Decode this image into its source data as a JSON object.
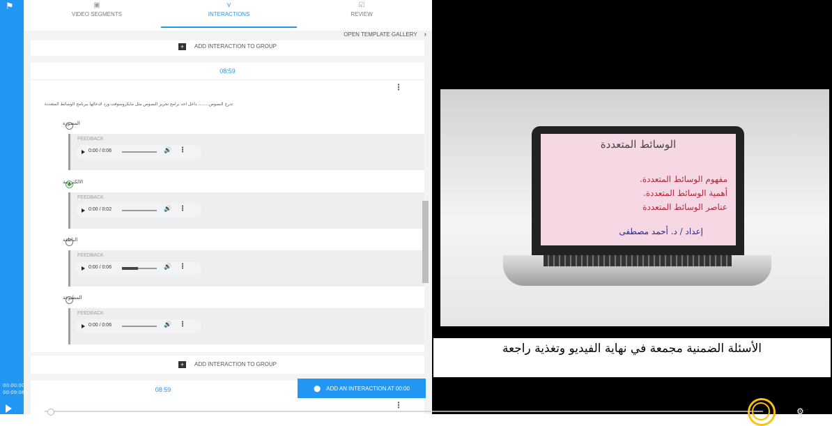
{
  "sidebar": {
    "time_current": "00:00:00",
    "time_total": "00:09:08"
  },
  "tabs": [
    {
      "label": "VIDEO SEGMENTS",
      "icon": "video-icon",
      "active": false
    },
    {
      "label": "INTERACTIONS",
      "icon": "interactions-icon",
      "active": true
    },
    {
      "label": "REVIEW",
      "icon": "review-icon",
      "active": false
    }
  ],
  "gallery_link": "OPEN TEMPLATE GALLERY",
  "add_to_group_label": "ADD INTERACTION TO GROUP",
  "interaction1": {
    "timestamp": "08:59",
    "question": "تدرج النصوص........ داخل احد برامج تحرير النصوص مثل مايكروسوفت ورد لادخالها ببرنامج الوسائط المتعددة",
    "feedback_label": "FEEDBACK",
    "options": [
      {
        "label": "المصورة",
        "checked": false,
        "audio_time": "0:00 / 0:06",
        "progress": 0.0
      },
      {
        "label": "الالكترونية",
        "checked": true,
        "audio_time": "0:00 / 0:02",
        "progress": 0.0
      },
      {
        "label": "الناطقة",
        "checked": false,
        "audio_time": "0:00 / 0:06",
        "progress": 0.45
      },
      {
        "label": "المطبوعة",
        "checked": false,
        "audio_time": "0:00 / 0:06",
        "progress": 0.0
      }
    ]
  },
  "interaction2": {
    "timestamp": "08:59"
  },
  "add_interaction_button": "ADD AN INTERACTION AT 00:00",
  "slide": {
    "title": "الوسائط المتعددة",
    "lines": [
      "مفهوم الوسائط المتعددة.",
      "أهمية الوسائط المتعددة.",
      "عناصر الوسائط المتعددة"
    ],
    "author": "إعداد / د. أحمد مصطفى"
  },
  "caption": "الأسئلة الضمنية مجمعة في نهاية الفيديو وتغذية راجعة",
  "colors": {
    "accent": "#2196f3",
    "correct": "#4caf50",
    "highlight": "#ffc107"
  }
}
